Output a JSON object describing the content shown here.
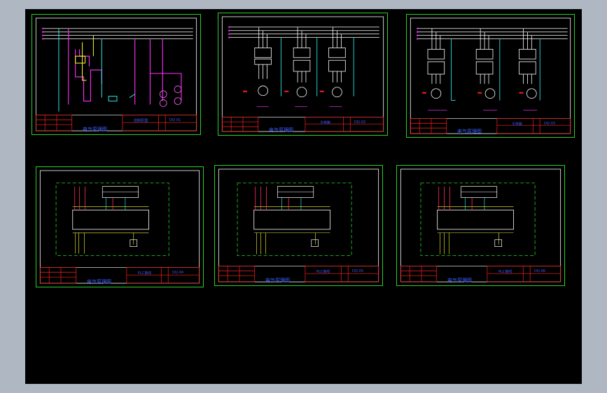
{
  "app": {
    "view": "cad-model-space",
    "background_color": "#000000",
    "chrome_color": "#aeb7c2"
  },
  "sheets": [
    {
      "kind": "control-circuit",
      "title_block": {
        "drawing_title": "电气原理图",
        "name": "控制原理",
        "code": "DQ-01"
      }
    },
    {
      "kind": "motor-circuit",
      "title_block": {
        "drawing_title": "电气原理图",
        "name": "主电路",
        "code": "DQ-02"
      }
    },
    {
      "kind": "motor-circuit-2",
      "title_block": {
        "drawing_title": "电气原理图",
        "name": "主电路",
        "code": "DQ-03"
      }
    },
    {
      "kind": "plc-wiring",
      "title_block": {
        "drawing_title": "电气原理图",
        "name": "PLC接线",
        "code": "DQ-04"
      }
    },
    {
      "kind": "plc-wiring",
      "title_block": {
        "drawing_title": "电气原理图",
        "name": "PLC接线",
        "code": "DQ-05"
      }
    },
    {
      "kind": "plc-wiring",
      "title_block": {
        "drawing_title": "电气原理图",
        "name": "PLC接线",
        "code": "DQ-06"
      }
    }
  ],
  "colors": {
    "frame": "#28d228",
    "bus": "#ffffff",
    "phase": "#ff3355",
    "accent": "#ff33ff",
    "wire_yellow": "#e8e850",
    "text_blue": "#3a5cff",
    "cyan": "#33ffff",
    "red": "#ff2020"
  }
}
